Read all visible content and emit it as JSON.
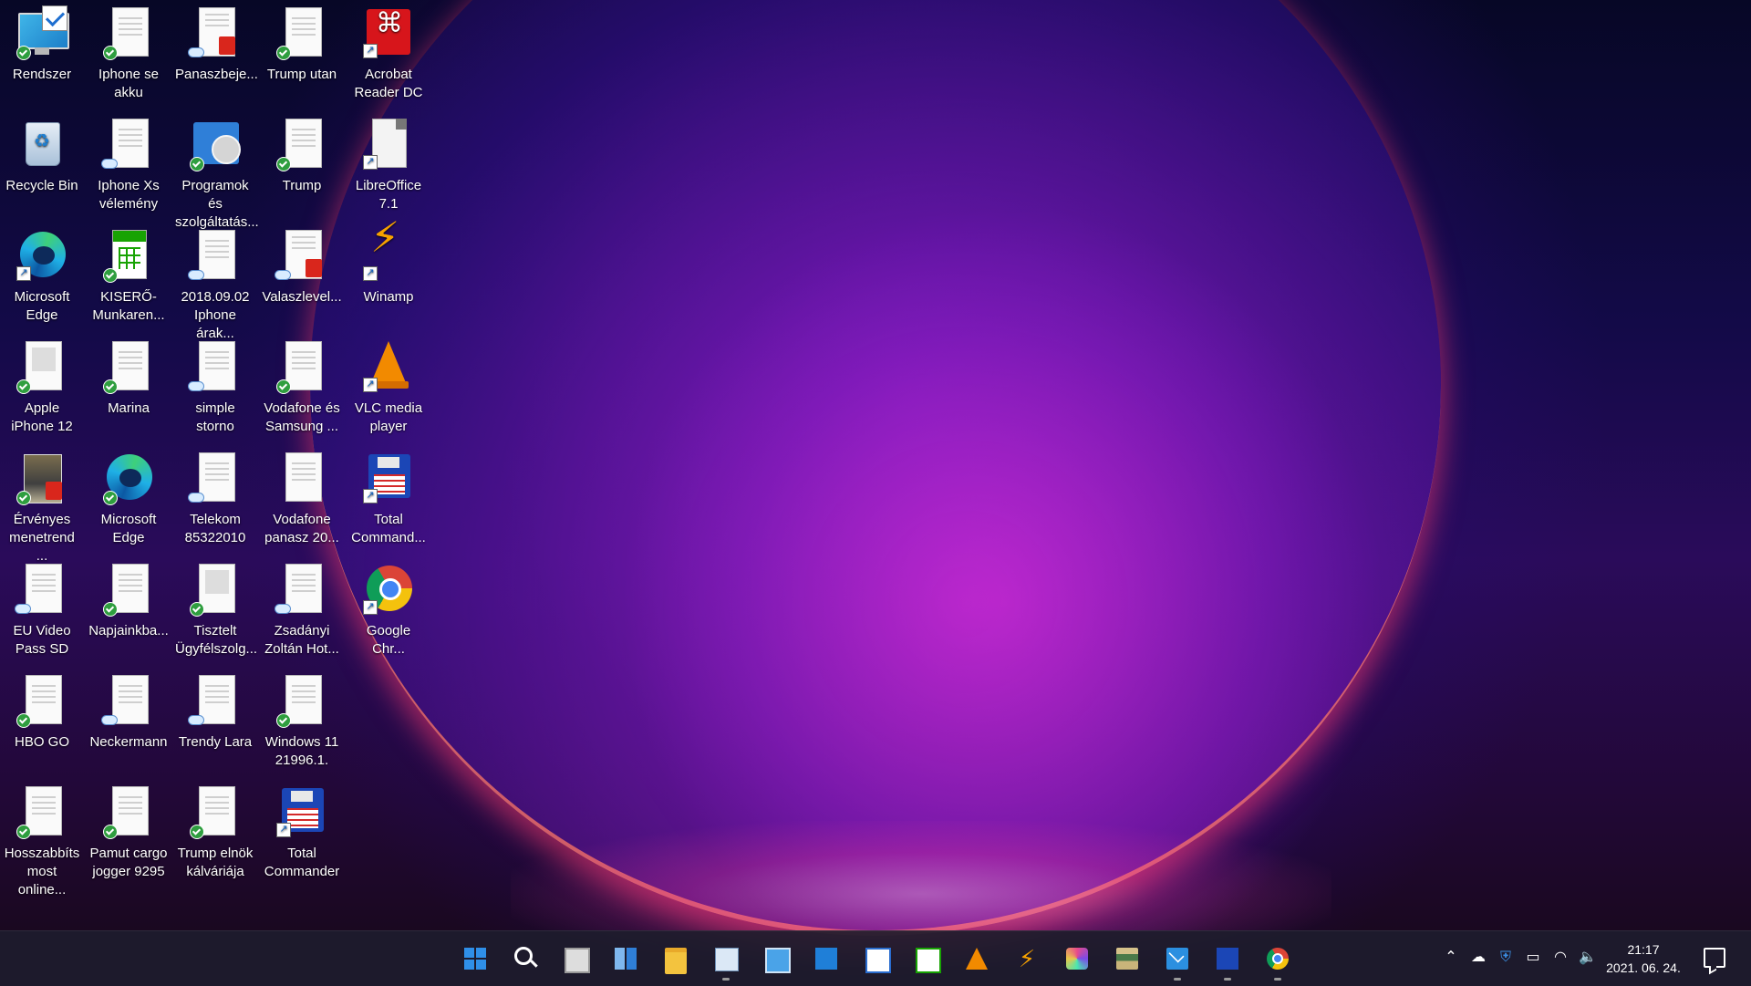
{
  "desktop": {
    "icons": [
      {
        "label": "Rendszer"
      },
      {
        "label": "Iphone se akku"
      },
      {
        "label": "Panaszbeje..."
      },
      {
        "label": "Trump utan"
      },
      {
        "label": "Acrobat Reader DC"
      },
      {
        "label": "Recycle Bin"
      },
      {
        "label": "Iphone Xs vélemény"
      },
      {
        "label": "Programok és szolgáltatás..."
      },
      {
        "label": "Trump"
      },
      {
        "label": "LibreOffice 7.1"
      },
      {
        "label": "Microsoft Edge"
      },
      {
        "label": "KISERŐ-Munkaren..."
      },
      {
        "label": "2018.09.02 Iphone árak..."
      },
      {
        "label": "Valaszlevel..."
      },
      {
        "label": "Winamp"
      },
      {
        "label": "Apple iPhone 12"
      },
      {
        "label": "Marina"
      },
      {
        "label": "simple storno"
      },
      {
        "label": "Vodafone és Samsung ..."
      },
      {
        "label": "VLC media player"
      },
      {
        "label": "Érvényes menetrend ..."
      },
      {
        "label": "Microsoft Edge"
      },
      {
        "label": "Telekom 85322010"
      },
      {
        "label": "Vodafone panasz 20..."
      },
      {
        "label": "Total Command..."
      },
      {
        "label": "EU Video Pass SD"
      },
      {
        "label": "Napjainkba..."
      },
      {
        "label": "Tisztelt Ügyfélszolg..."
      },
      {
        "label": "Zsadányi Zoltán Hot..."
      },
      {
        "label": "Google Chr..."
      },
      {
        "label": "HBO GO"
      },
      {
        "label": "Neckermann"
      },
      {
        "label": "Trendy Lara"
      },
      {
        "label": "Windows 11 21996.1."
      },
      {
        "label": "Hosszabbíts most online..."
      },
      {
        "label": "Pamut cargo jogger 9295"
      },
      {
        "label": "Trump elnök kálváriája"
      },
      {
        "label": "Total Commander"
      }
    ]
  },
  "taskbar": {
    "apps": [
      {
        "icon": "windows-start-icon"
      },
      {
        "icon": "search-icon"
      },
      {
        "icon": "task-view-icon"
      },
      {
        "icon": "widgets-icon"
      },
      {
        "icon": "file-explorer-icon"
      },
      {
        "icon": "performance-monitor-icon"
      },
      {
        "icon": "control-panel-icon"
      },
      {
        "icon": "notepad-icon"
      },
      {
        "icon": "libreoffice-writer-icon"
      },
      {
        "icon": "libreoffice-calc-icon"
      },
      {
        "icon": "vlc-icon"
      },
      {
        "icon": "winamp-icon"
      },
      {
        "icon": "paint-icon"
      },
      {
        "icon": "library-icon"
      },
      {
        "icon": "mail-icon"
      },
      {
        "icon": "total-commander-icon"
      },
      {
        "icon": "chrome-icon"
      }
    ],
    "tray": {
      "time": "21:17",
      "date": "2021. 06. 24."
    }
  },
  "colors": {
    "taskbar": "#201c2c",
    "accent": "#2f8fe8"
  }
}
